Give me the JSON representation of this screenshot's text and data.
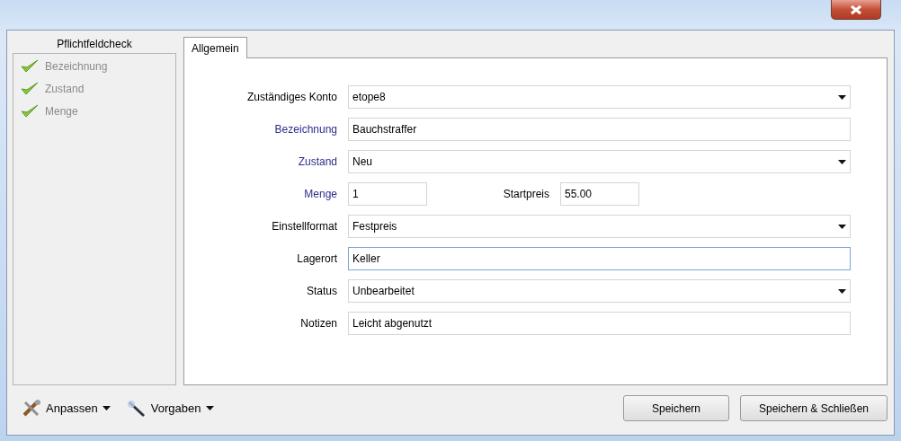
{
  "check_panel": {
    "title": "Pflichtfeldcheck",
    "items": [
      {
        "label": "Bezeichnung",
        "ok": true
      },
      {
        "label": "Zustand",
        "ok": true
      },
      {
        "label": "Menge",
        "ok": true
      }
    ]
  },
  "tabs": [
    {
      "label": "Allgemein",
      "selected": true
    }
  ],
  "form": [
    {
      "kind": "dropdown",
      "label": "Zuständiges Konto",
      "value": "etope8",
      "required": false,
      "focused": false
    },
    {
      "kind": "text",
      "label": "Bezeichnung",
      "value": "Bauchstraffer",
      "required": true,
      "focused": false
    },
    {
      "kind": "dropdown",
      "label": "Zustand",
      "value": "Neu",
      "required": true,
      "focused": false
    },
    {
      "kind": "pair",
      "label": "Menge",
      "value": "1",
      "required": true,
      "focused": false,
      "label_2": "Startpreis",
      "value_2": "55.00"
    },
    {
      "kind": "dropdown",
      "label": "Einstellformat",
      "value": "Festpreis",
      "required": false,
      "focused": false
    },
    {
      "kind": "text",
      "label": "Lagerort",
      "value": "Keller",
      "required": false,
      "focused": true
    },
    {
      "kind": "dropdown",
      "label": "Status",
      "value": "Unbearbeitet",
      "required": false,
      "focused": false
    },
    {
      "kind": "text",
      "label": "Notizen",
      "value": "Leicht abgenutzt",
      "required": false,
      "focused": false
    }
  ],
  "tools": [
    {
      "kind": "tools",
      "label": "Anpassen"
    },
    {
      "kind": "wand",
      "label": "Vorgaben"
    }
  ],
  "buttons": [
    "Speichern",
    "Speichern & Schließen"
  ]
}
